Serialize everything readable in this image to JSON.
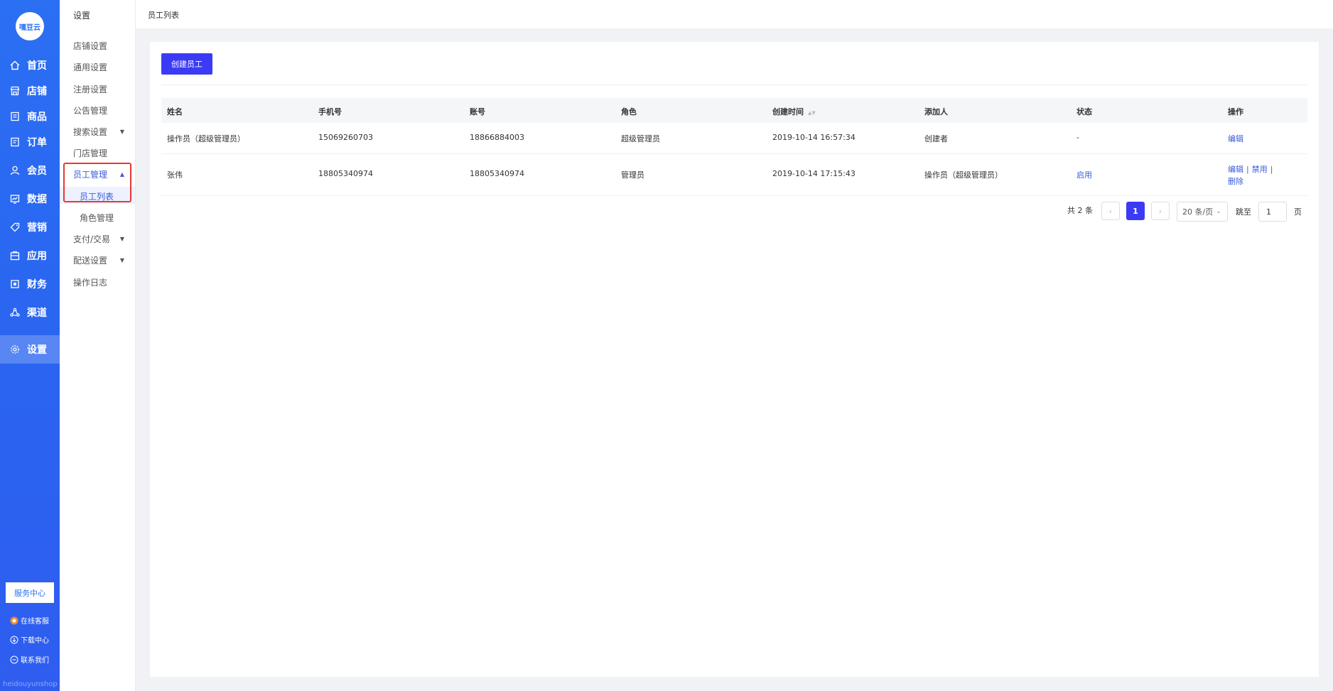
{
  "brand": {
    "logo_text": "嘿豆云"
  },
  "primary_nav": [
    {
      "label": "首页",
      "icon": "home-icon",
      "active": false
    },
    {
      "label": "店铺",
      "icon": "store-icon",
      "active": false
    },
    {
      "label": "商品",
      "icon": "goods-icon",
      "active": false
    },
    {
      "label": "订单",
      "icon": "order-icon",
      "active": false
    },
    {
      "label": "会员",
      "icon": "user-icon",
      "active": false
    },
    {
      "label": "数据",
      "icon": "chart-icon",
      "active": false
    },
    {
      "label": "营销",
      "icon": "tag-icon",
      "active": false
    },
    {
      "label": "应用",
      "icon": "app-icon",
      "active": false
    },
    {
      "label": "财务",
      "icon": "finance-icon",
      "active": false
    },
    {
      "label": "渠道",
      "icon": "channel-icon",
      "active": false
    },
    {
      "label": "设置",
      "icon": "gear-icon",
      "active": true
    }
  ],
  "service": {
    "button_label": "服务中心",
    "online_service": "在线客服",
    "download_center": "下载中心",
    "contact_us": "联系我们",
    "footer_text": "heidouyunshop"
  },
  "secondary_nav": {
    "title": "设置",
    "items": [
      {
        "label": "店铺设置",
        "caret": ""
      },
      {
        "label": "通用设置",
        "caret": ""
      },
      {
        "label": "注册设置",
        "caret": ""
      },
      {
        "label": "公告管理",
        "caret": ""
      },
      {
        "label": "搜索设置",
        "caret": "▼"
      },
      {
        "label": "门店管理",
        "caret": ""
      },
      {
        "label": "员工管理",
        "caret": "▲"
      },
      {
        "label": "员工列表",
        "caret": ""
      },
      {
        "label": "角色管理",
        "caret": ""
      },
      {
        "label": "支付/交易",
        "caret": "▼"
      },
      {
        "label": "配送设置",
        "caret": "▼"
      },
      {
        "label": "操作日志",
        "caret": ""
      }
    ]
  },
  "breadcrumb": "员工列表",
  "toolbar": {
    "create_label": "创建员工"
  },
  "table": {
    "headers": [
      "姓名",
      "手机号",
      "账号",
      "角色",
      "创建时间",
      "添加人",
      "状态",
      "操作"
    ],
    "rows": [
      {
        "name": "操作员（超级管理员）",
        "phone": "15069260703",
        "account": "18866884003",
        "role": "超级管理员",
        "created": "2019-10-14 16:57:34",
        "added_by": "创建者",
        "status": "-",
        "actions": [
          "编辑"
        ]
      },
      {
        "name": "张伟",
        "phone": "18805340974",
        "account": "18805340974",
        "role": "管理员",
        "created": "2019-10-14 17:15:43",
        "added_by": "操作员（超级管理员）",
        "status": "启用",
        "actions": [
          "编辑",
          "禁用",
          "删除"
        ]
      }
    ]
  },
  "pagination": {
    "total": "共 2 条",
    "prev": "‹",
    "current": "1",
    "next": "›",
    "page_size": "20 条/页",
    "jump_label": "跳至",
    "jump_value": "1",
    "page_label": "页"
  },
  "colors": {
    "primary": "#3b3bf5",
    "nav_bg": "#2b6ff3",
    "link": "#3b5bdb",
    "highlight": "#e53935"
  }
}
